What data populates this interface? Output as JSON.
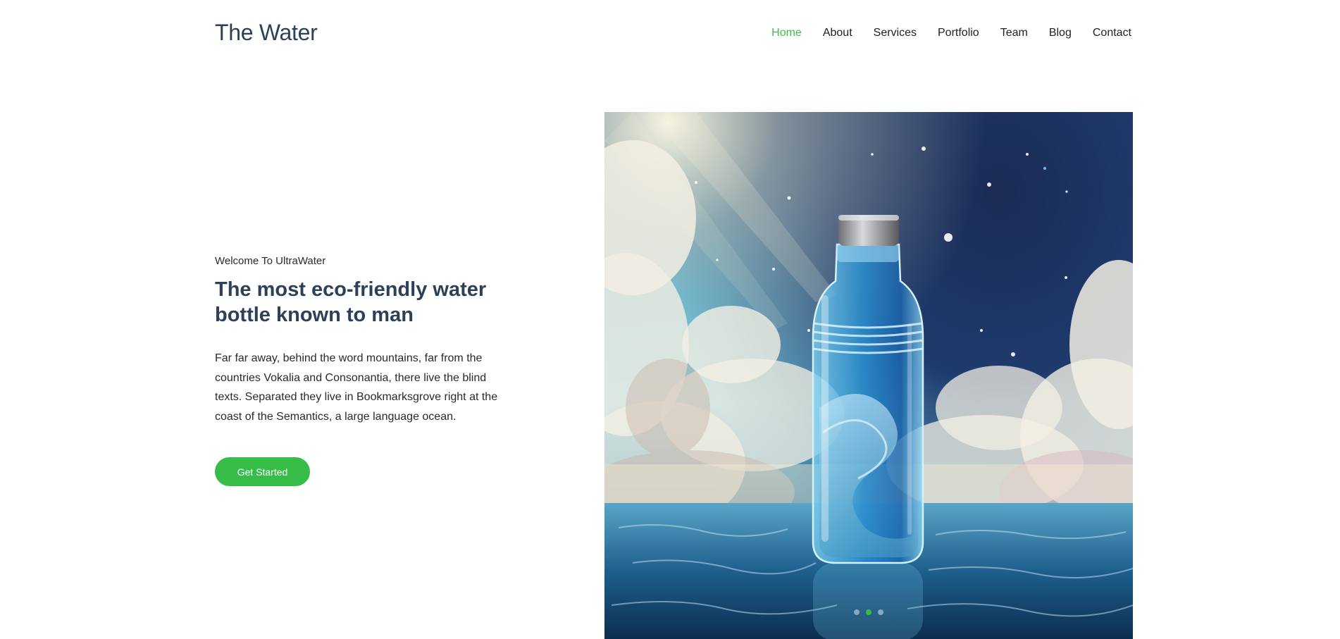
{
  "header": {
    "logo": "The Water",
    "nav": [
      {
        "label": "Home",
        "active": true
      },
      {
        "label": "About",
        "active": false
      },
      {
        "label": "Services",
        "active": false
      },
      {
        "label": "Portfolio",
        "active": false
      },
      {
        "label": "Team",
        "active": false
      },
      {
        "label": "Blog",
        "active": false
      },
      {
        "label": "Contact",
        "active": false
      }
    ]
  },
  "hero": {
    "kicker": "Welcome To UltraWater",
    "headline": "The most eco-friendly water bottle known to man",
    "body": "Far far away, behind the word mountains, far from the countries Vokalia and Consonantia, there live the blind texts. Separated they live in Bookmarksgrove right at the coast of the Semantics, a large language ocean.",
    "cta_label": "Get Started",
    "slider": {
      "count": 3,
      "active_index": 1
    }
  },
  "colors": {
    "accent": "#35bd47",
    "nav_active": "#3bbf4a",
    "heading": "#2c4159"
  }
}
